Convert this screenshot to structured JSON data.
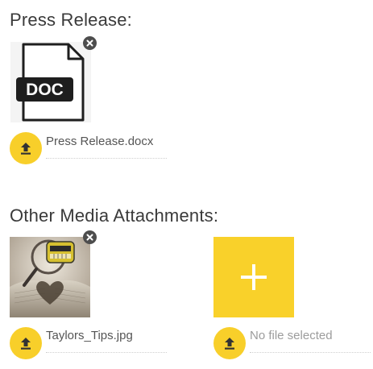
{
  "press_release": {
    "title": "Press Release:",
    "file_icon": "doc-file-icon",
    "file_icon_text": "DOC",
    "filename": "Press Release.docx"
  },
  "media": {
    "title": "Other Media Attachments:",
    "items": [
      {
        "filename": "Taylors_Tips.jpg",
        "thumbnail": "heart-book-photo"
      }
    ],
    "new_item": {
      "filename": "No file selected"
    }
  },
  "colors": {
    "accent": "#f9d12a",
    "remove": "#4d4d4d",
    "text": "#3a3a3a",
    "muted": "#9c9c9c"
  }
}
